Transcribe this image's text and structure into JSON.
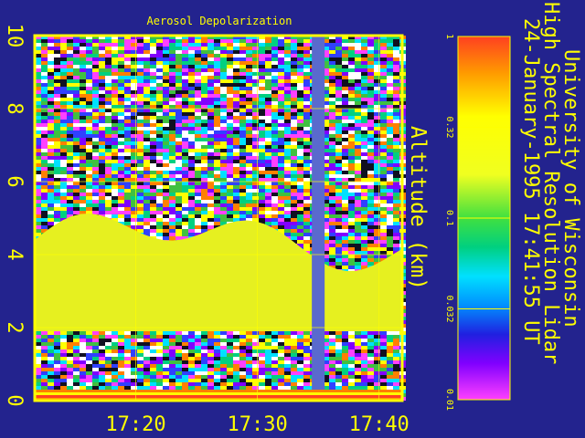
{
  "chart_data": {
    "type": "heatmap",
    "title": "Aerosol Depolarization",
    "xlabel": "",
    "ylabel": "Altitude (km)",
    "x_ticks": [
      "17:20",
      "17:30",
      "17:40"
    ],
    "y_ticks": [
      "0",
      "2",
      "4",
      "6",
      "8",
      "10"
    ],
    "ylim": [
      0,
      10
    ],
    "colorbar_ticks": [
      "1",
      "0.32",
      "0.1",
      "0.032",
      "0.01"
    ],
    "colorbar_scale": "log",
    "cloud_layer": {
      "base_km": 1.9,
      "top_km_range": [
        3.5,
        5.3
      ],
      "approx_depolarization": 0.3
    },
    "data_gap": {
      "approx_time": "17:35"
    },
    "grid": true,
    "colors": {
      "background": "#23238e",
      "frame": "#ffff00",
      "cloud": "#e6f020",
      "gap": "#5a6acd"
    },
    "credits": [
      "University of Wisconsin",
      "High Spectral Resolution Lidar",
      "24-January-1995 17:41:55 UT"
    ]
  }
}
